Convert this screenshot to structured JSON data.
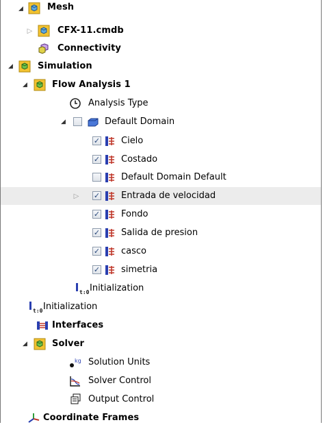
{
  "tree": {
    "mesh": {
      "label": "Mesh"
    },
    "cmdb": {
      "label": "CFX-11.cmdb"
    },
    "connectivity": {
      "label": "Connectivity"
    },
    "simulation": {
      "label": "Simulation"
    },
    "flow_analysis": {
      "label": "Flow Analysis 1"
    },
    "analysis_type": {
      "label": "Analysis Type"
    },
    "default_domain": {
      "label": "Default Domain",
      "checked": false
    },
    "boundaries": [
      {
        "label": "Cielo",
        "checked": true
      },
      {
        "label": "Costado",
        "checked": true
      },
      {
        "label": "Default Domain Default",
        "checked": false
      },
      {
        "label": "Entrada de velocidad",
        "checked": true
      },
      {
        "label": "Fondo",
        "checked": true
      },
      {
        "label": "Salida de presion",
        "checked": true
      },
      {
        "label": "casco",
        "checked": true
      },
      {
        "label": "simetria",
        "checked": true
      }
    ],
    "domain_initialization": {
      "label": "Initialization",
      "icon_text": "t:0"
    },
    "global_initialization": {
      "label": "Initialization",
      "icon_text": "t:0"
    },
    "interfaces": {
      "label": "Interfaces"
    },
    "solver": {
      "label": "Solver"
    },
    "solution_units": {
      "label": "Solution Units",
      "icon_text": "kg"
    },
    "solver_control": {
      "label": "Solver Control"
    },
    "output_control": {
      "label": "Output Control"
    },
    "coordinate_frames": {
      "label": "Coordinate Frames"
    }
  },
  "colors": {
    "boundary_blue": "#2a3fb0",
    "boundary_red": "#c0392b",
    "check": "#2b4a7c",
    "highlight": "#ececec"
  },
  "icons": {
    "mesh": "mesh-cube-icon",
    "cmdb": "mesh-file-icon",
    "connectivity": "connectivity-icon",
    "simulation": "simulation-icon",
    "flow_analysis": "flow-analysis-icon",
    "analysis_type": "clock-icon",
    "default_domain": "domain-icon",
    "boundary": "boundary-icon",
    "initialization": "initialization-icon",
    "interfaces": "interfaces-icon",
    "solver": "solver-icon",
    "solution_units": "units-icon",
    "solver_control": "solver-control-icon",
    "output_control": "output-control-icon",
    "coordinate_frames": "axes-icon"
  }
}
